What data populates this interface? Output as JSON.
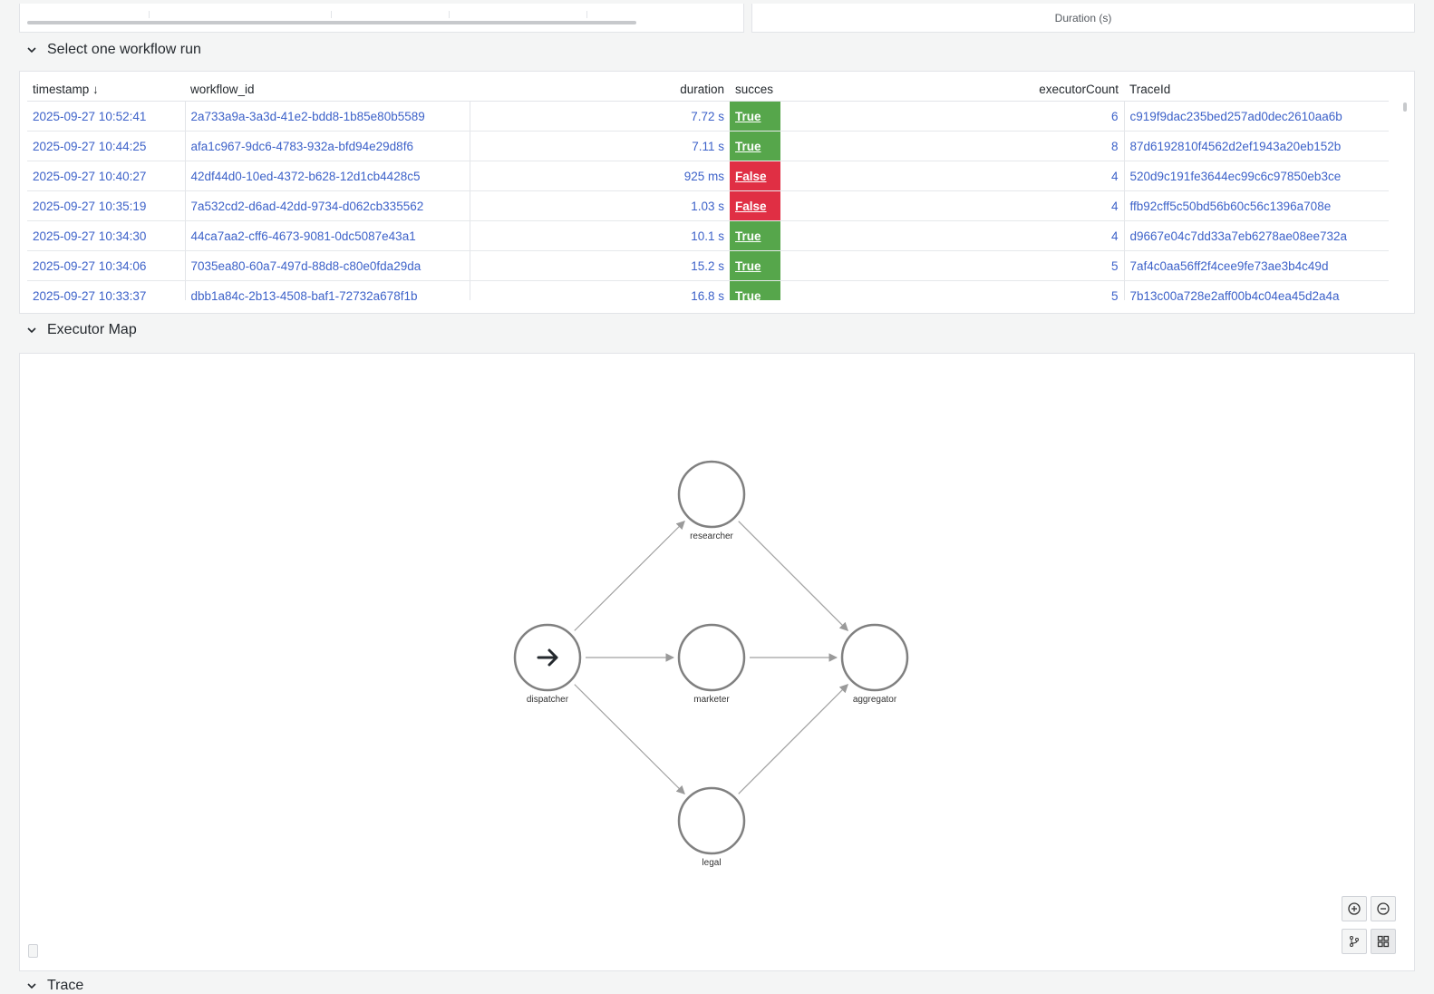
{
  "top_panels": {
    "right_axis_title": "Duration (s)"
  },
  "sections": {
    "runs_title": "Select one workflow run",
    "map_title": "Executor Map",
    "next_title": "Trace"
  },
  "table": {
    "columns": [
      "timestamp",
      "workflow_id",
      "duration",
      "succes",
      "executorCount",
      "TraceId"
    ],
    "sort_indicator": "↓",
    "rows": [
      {
        "timestamp": "2025-09-27 10:52:41",
        "workflow_id": "2a733a9a-3a3d-41e2-bdd8-1b85e80b5589",
        "duration": "7.72 s",
        "success": "True",
        "executorCount": "6",
        "traceId": "c919f9dac235bed257ad0dec2610aa6b"
      },
      {
        "timestamp": "2025-09-27 10:44:25",
        "workflow_id": "afa1c967-9dc6-4783-932a-bfd94e29d8f6",
        "duration": "7.11 s",
        "success": "True",
        "executorCount": "8",
        "traceId": "87d6192810f4562d2ef1943a20eb152b"
      },
      {
        "timestamp": "2025-09-27 10:40:27",
        "workflow_id": "42df44d0-10ed-4372-b628-12d1cb4428c5",
        "duration": "925 ms",
        "success": "False",
        "executorCount": "4",
        "traceId": "520d9c191fe3644ec99c6c97850eb3ce"
      },
      {
        "timestamp": "2025-09-27 10:35:19",
        "workflow_id": "7a532cd2-d6ad-42dd-9734-d062cb335562",
        "duration": "1.03 s",
        "success": "False",
        "executorCount": "4",
        "traceId": "ffb92cff5c50bd56b60c56c1396a708e"
      },
      {
        "timestamp": "2025-09-27 10:34:30",
        "workflow_id": "44ca7aa2-cff6-4673-9081-0dc5087e43a1",
        "duration": "10.1 s",
        "success": "True",
        "executorCount": "4",
        "traceId": "d9667e04c7dd33a7eb6278ae08ee732a"
      },
      {
        "timestamp": "2025-09-27 10:34:06",
        "workflow_id": "7035ea80-60a7-497d-88d8-c80e0fda29da",
        "duration": "15.2 s",
        "success": "True",
        "executorCount": "5",
        "traceId": "7af4c0aa56ff2f4cee9fe73ae3b4c49d"
      },
      {
        "timestamp": "2025-09-27 10:33:37",
        "workflow_id": "dbb1a84c-2b13-4508-baf1-72732a678f1b",
        "duration": "16.8 s",
        "success": "True",
        "executorCount": "5",
        "traceId": "7b13c00a728e2aff00b4c04ea45d2a4a"
      }
    ]
  },
  "graph": {
    "nodes": [
      {
        "id": "dispatcher",
        "label": "dispatcher",
        "icon": "arrow-right-icon"
      },
      {
        "id": "researcher",
        "label": "researcher"
      },
      {
        "id": "marketer",
        "label": "marketer"
      },
      {
        "id": "legal",
        "label": "legal"
      },
      {
        "id": "aggregator",
        "label": "aggregator"
      }
    ],
    "edges": [
      [
        "dispatcher",
        "researcher"
      ],
      [
        "dispatcher",
        "marketer"
      ],
      [
        "dispatcher",
        "legal"
      ],
      [
        "researcher",
        "aggregator"
      ],
      [
        "marketer",
        "aggregator"
      ],
      [
        "legal",
        "aggregator"
      ]
    ]
  },
  "controls": {
    "zoom_in_icon": "zoom-in-icon",
    "zoom_out_icon": "zoom-out-icon",
    "layout_icon": "layout-icon",
    "grid_icon": "grid-icon"
  },
  "colors": {
    "success": "#56a64b",
    "failure": "#e02f44",
    "link": "#3d62c9"
  }
}
